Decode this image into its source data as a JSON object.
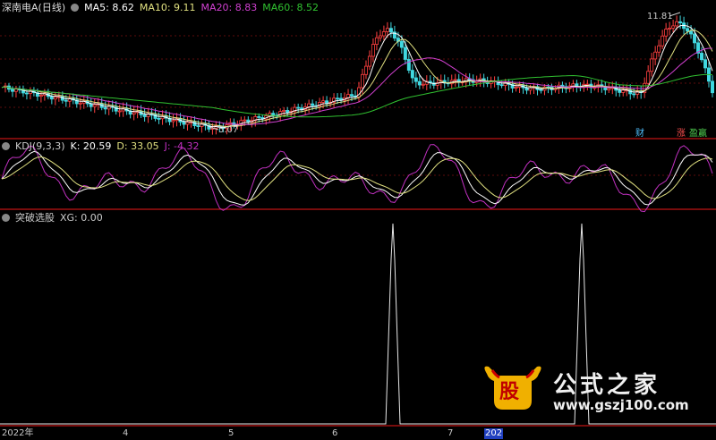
{
  "header_price": {
    "stock_title": "深南电A(日线)",
    "ma5_label": "MA5: 8.62",
    "ma10_label": "MA10: 9.11",
    "ma20_label": "MA20: 8.83",
    "ma60_label": "MA60: 8.52"
  },
  "header_kdj": {
    "title": "KDJ(9,3,3)",
    "k_label": "K: 20.59",
    "d_label": "D: 33.05",
    "j_label": "J: -4.32"
  },
  "header_xg": {
    "title": "突破选股",
    "xg_label": "XG: 0.00"
  },
  "annotations": {
    "high_label": "11.81",
    "low_label": "5.07",
    "badge_cai": "财",
    "badge_zhang": "涨",
    "badge_yingpan": "盈赢"
  },
  "watermark": {
    "logo_char": "股",
    "title": "公式之家",
    "url": "www.gszj100.com"
  },
  "colors": {
    "up": "#ff4040",
    "down": "#40d8e0",
    "ma5": "#ffffff",
    "ma10": "#e0e080",
    "ma20": "#d040d0",
    "ma60": "#30c030",
    "kdj_k": "#ffffff",
    "kdj_d": "#e0e080",
    "kdj_j": "#c030c0",
    "separator": "#a01010"
  },
  "chart_data": [
    {
      "type": "candlestick",
      "title": "深南电A(日线)",
      "price_high": 11.81,
      "price_low": 5.07,
      "series": [
        {
          "name": "MA5",
          "value": 8.62
        },
        {
          "name": "MA10",
          "value": 9.11
        },
        {
          "name": "MA20",
          "value": 8.83
        },
        {
          "name": "MA60",
          "value": 8.52
        }
      ]
    },
    {
      "type": "line",
      "title": "KDJ(9,3,3)",
      "series": [
        {
          "name": "K",
          "value": 20.59
        },
        {
          "name": "D",
          "value": 33.05
        },
        {
          "name": "J",
          "value": -4.32
        }
      ]
    },
    {
      "type": "line",
      "title": "突破选股",
      "series": [
        {
          "name": "XG",
          "value": 0.0
        }
      ],
      "spikes_at_month": [
        "6",
        "7"
      ]
    }
  ],
  "x_axis": {
    "ticks": [
      "2022年",
      "4",
      "5",
      "6",
      "7",
      "202"
    ]
  }
}
